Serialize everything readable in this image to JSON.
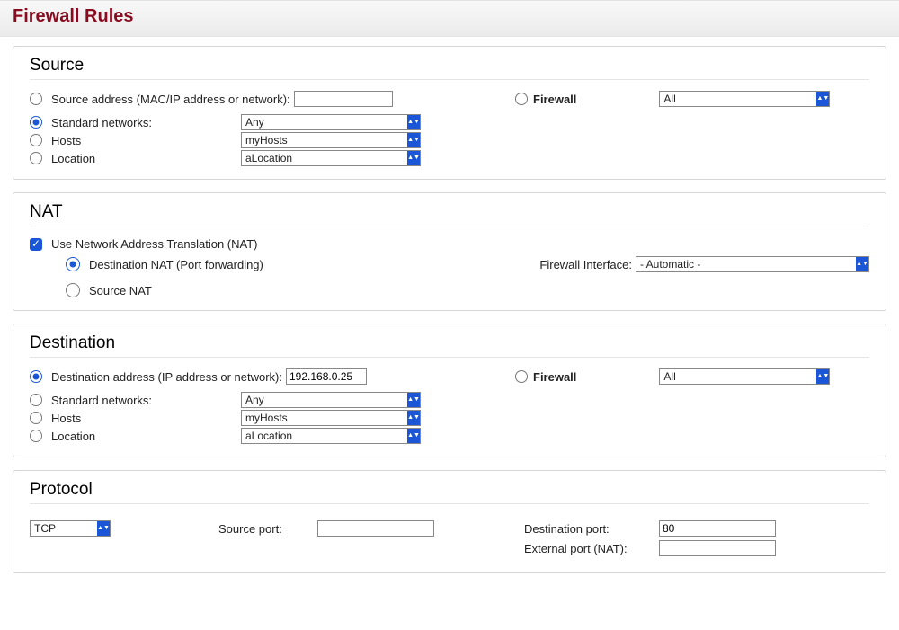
{
  "title": "Firewall Rules",
  "source": {
    "heading": "Source",
    "addr_label": "Source address (MAC/IP address or network):",
    "addr_value": "",
    "firewall_label": "Firewall",
    "firewall_select": "All",
    "std_label": "Standard networks:",
    "std_value": "Any",
    "hosts_label": "Hosts",
    "hosts_value": "myHosts",
    "loc_label": "Location",
    "loc_value": "aLocation"
  },
  "nat": {
    "heading": "NAT",
    "use_label": "Use Network Address Translation (NAT)",
    "dest_label": "Destination NAT (Port forwarding)",
    "src_label": "Source NAT",
    "iface_label": "Firewall Interface:",
    "iface_value": "- Automatic -"
  },
  "dest": {
    "heading": "Destination",
    "addr_label": "Destination address (IP address or network):",
    "addr_value": "192.168.0.25",
    "firewall_label": "Firewall",
    "firewall_select": "All",
    "std_label": "Standard networks:",
    "std_value": "Any",
    "hosts_label": "Hosts",
    "hosts_value": "myHosts",
    "loc_label": "Location",
    "loc_value": "aLocation"
  },
  "proto": {
    "heading": "Protocol",
    "value": "TCP",
    "src_port_label": "Source port:",
    "src_port_value": "",
    "dst_port_label": "Destination port:",
    "dst_port_value": "80",
    "ext_port_label": "External port (NAT):",
    "ext_port_value": ""
  }
}
